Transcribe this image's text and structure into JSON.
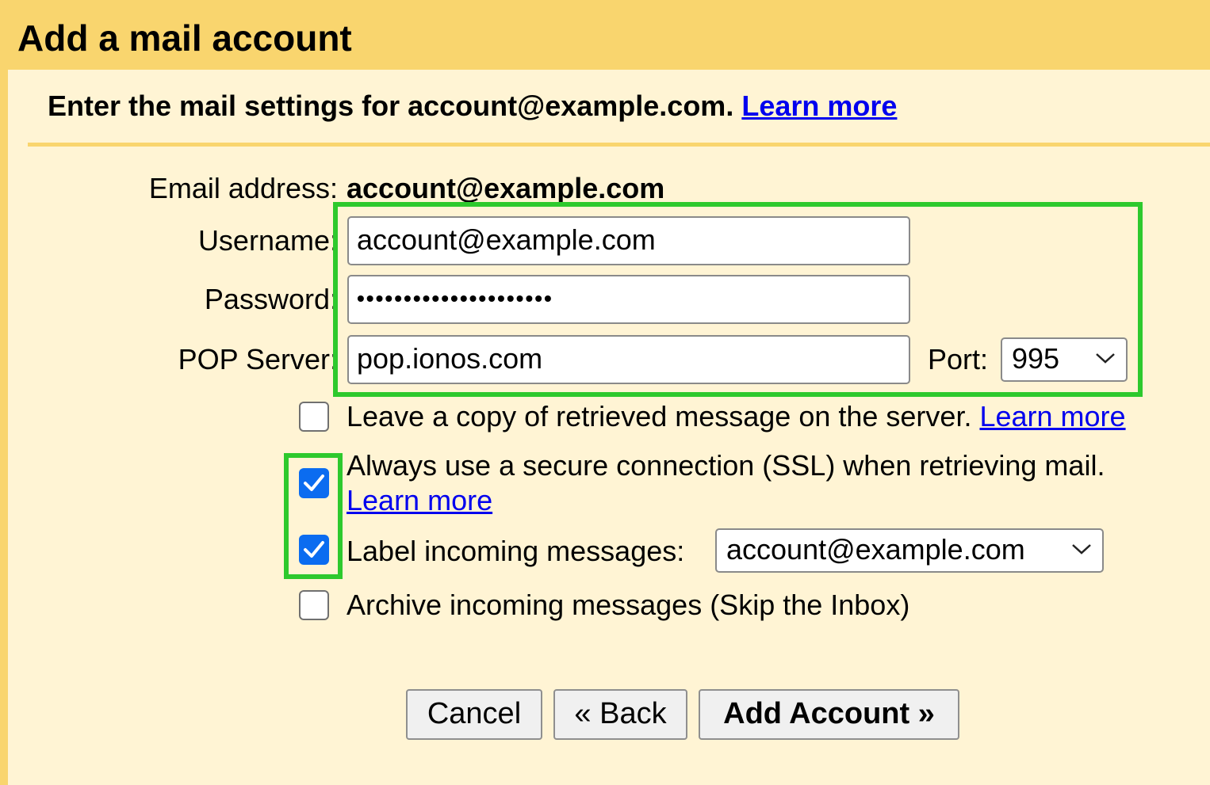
{
  "window": {
    "title": "Add a mail account"
  },
  "header": {
    "text": "Enter the mail settings for account@example.com.",
    "learn_more": "Learn more"
  },
  "form": {
    "email_label": "Email address:",
    "email_value": "account@example.com",
    "username_label": "Username:",
    "username_value": "account@example.com",
    "password_label": "Password:",
    "password_value": "•••••••••••••••••••••",
    "pop_server_label": "POP Server:",
    "pop_server_value": "pop.ionos.com",
    "port_label": "Port:",
    "port_value": "995"
  },
  "options": {
    "leave_copy": {
      "label": "Leave a copy of retrieved message on the server.",
      "link": "Learn more",
      "checked": false
    },
    "ssl": {
      "label": "Always use a secure connection (SSL) when retrieving mail.",
      "link": "Learn more",
      "checked": true
    },
    "label_incoming": {
      "label": "Label incoming messages:",
      "value": "account@example.com",
      "checked": true
    },
    "archive": {
      "label": "Archive incoming messages (Skip the Inbox)",
      "checked": false
    }
  },
  "buttons": {
    "cancel": "Cancel",
    "back": "« Back",
    "add_account": "Add Account »"
  },
  "colors": {
    "accent": "#f9d56e",
    "panel": "#fff4d4",
    "highlight": "#2dc92d",
    "checkbox": "#0b6cf0",
    "link": "#0000ee"
  },
  "icons": [
    "chevron-down-icon",
    "checkmark-icon"
  ]
}
